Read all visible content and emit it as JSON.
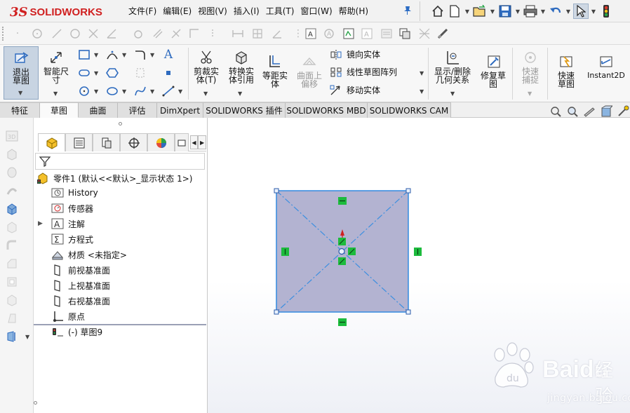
{
  "app": {
    "logo_prefix": "3S",
    "logo_name": "SOLIDWORKS"
  },
  "menu": [
    "文件(F)",
    "编辑(E)",
    "视图(V)",
    "插入(I)",
    "工具(T)",
    "窗口(W)",
    "帮助(H)"
  ],
  "quick_access": [
    "home-icon",
    "new-document-icon",
    "open-icon",
    "save-icon",
    "print-icon",
    "undo-icon",
    "select-cursor-icon",
    "traffic-light-icon"
  ],
  "ribbon": {
    "exit_sketch": "退出草图",
    "smart_dimension": "智能尺寸",
    "trim": "剪裁实体(T)",
    "convert": "转换实体引用",
    "offset": "等距实体",
    "offset_surface": "曲面上偏移",
    "mirror": "镜向实体",
    "linear_pattern": "线性草图阵列",
    "move": "移动实体",
    "display_relations": "显示/删除几何关系",
    "repair_sketch": "修复草图",
    "quick_snaps": "快速捕捉",
    "rapid_sketch": "快速草图",
    "instant2d": "Instant2D"
  },
  "tabs": [
    "特征",
    "草图",
    "曲面",
    "评估",
    "DimXpert",
    "SOLIDWORKS 插件",
    "SOLIDWORKS MBD",
    "SOLIDWORKS CAM"
  ],
  "active_tab": "草图",
  "tree": {
    "part": "零件1  (默认<<默认>_显示状态 1>)",
    "items": [
      {
        "label": "History",
        "icon": "history-folder-icon"
      },
      {
        "label": "传感器",
        "icon": "sensor-icon"
      },
      {
        "label": "注解",
        "icon": "annotation-icon",
        "expandable": true
      },
      {
        "label": "方程式",
        "icon": "equation-icon"
      },
      {
        "label": "材质 <未指定>",
        "icon": "material-icon"
      },
      {
        "label": "前视基准面",
        "icon": "plane-icon"
      },
      {
        "label": "上视基准面",
        "icon": "plane-icon"
      },
      {
        "label": "右视基准面",
        "icon": "plane-icon"
      },
      {
        "label": "原点",
        "icon": "origin-icon"
      },
      {
        "label": "(-) 草图9",
        "icon": "sketch-icon"
      }
    ]
  },
  "watermark": {
    "brand": "Baidu",
    "cn": "经验",
    "url": "jingyan.baidu.com"
  },
  "colors": {
    "sketch_fill": "#b3b3d1",
    "sketch_line": "#3d8fe0",
    "relation_green": "#1dbb3d",
    "accent_red": "#d02020"
  }
}
